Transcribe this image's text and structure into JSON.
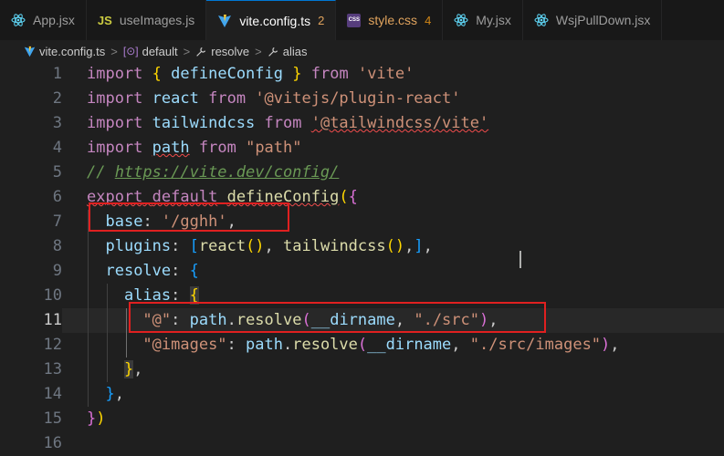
{
  "tabs": [
    {
      "name": "App.jsx",
      "icon": "react-icon"
    },
    {
      "name": "useImages.js",
      "icon": "js-icon"
    },
    {
      "name": "vite.config.ts",
      "badge": "2",
      "icon": "vite-icon",
      "active": true
    },
    {
      "name": "style.css",
      "badge": "4",
      "icon": "css-icon"
    },
    {
      "name": "My.jsx",
      "icon": "react-icon"
    },
    {
      "name": "WsjPullDown.jsx",
      "icon": "react-icon"
    }
  ],
  "breadcrumb": {
    "file": "vite.config.ts",
    "seg1": "default",
    "seg2": "resolve",
    "seg3": "alias",
    "sep": ">",
    "js_icon_label": "JS",
    "css_icon_label": "CSS",
    "default_icon_label": "[⊙]"
  },
  "lines": {
    "n1": "1",
    "n2": "2",
    "n3": "3",
    "n4": "4",
    "n5": "5",
    "n6": "6",
    "n7": "7",
    "n8": "8",
    "n9": "9",
    "n10": "10",
    "n11": "11",
    "n12": "12",
    "n13": "13",
    "n14": "14",
    "n15": "15",
    "n16": "16"
  },
  "tokens": {
    "import": "import",
    "from": "from",
    "export": "export",
    "default": "default",
    "defineConfig": "defineConfig",
    "react": "react",
    "tailwindcss": "tailwindcss",
    "path": "path",
    "str_vite": "'vite'",
    "str_plugin_react": "'@vitejs/plugin-react'",
    "str_tailwind_vite": "'@tailwindcss/vite'",
    "str_path": "\"path\"",
    "comment_prefix": "// ",
    "comment_url": "https://vite.dev/config/",
    "base": "base",
    "str_base": "'/gghh'",
    "plugins": "plugins",
    "resolve": "resolve",
    "alias": "alias",
    "str_at": "\"@\"",
    "str_images": "\"@images\"",
    "path_resolve": "resolve",
    "dirname": "__dirname",
    "str_src": "\"./src\"",
    "str_src_images": "\"./src/images\""
  },
  "colors": {
    "keyword": "#c586c0",
    "control": "#569cd6",
    "variable": "#9cdcfe",
    "function": "#dcdcaa",
    "string": "#ce9178",
    "comment": "#6a9955",
    "annotation_box": "#e02020",
    "active_tab_accent": "#0078d4"
  }
}
